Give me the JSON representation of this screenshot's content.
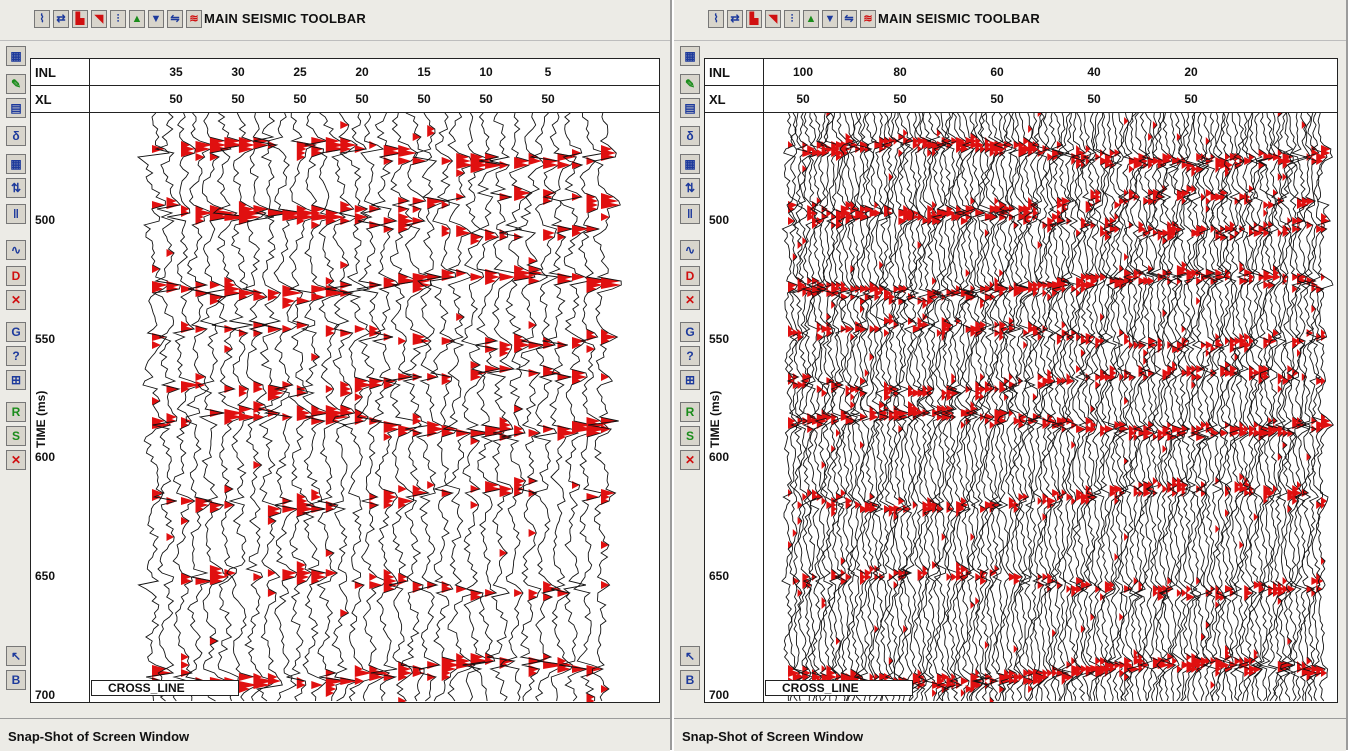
{
  "panels": [
    {
      "toolbar_title": "MAIN SEISMIC TOOLBAR",
      "inl_label": "INL",
      "xl_label": "XL",
      "inl_ticks": [
        "35",
        "30",
        "25",
        "20",
        "15",
        "10",
        "5"
      ],
      "xl_ticks": [
        "50",
        "50",
        "50",
        "50",
        "50",
        "50",
        "50"
      ],
      "y_axis_label": "TIME (ms)",
      "time_ticks": [
        "500",
        "550",
        "600",
        "650",
        "700"
      ],
      "legend": "CROSS_LINE",
      "status": "Snap-Shot of Screen Window"
    },
    {
      "toolbar_title": "MAIN SEISMIC TOOLBAR",
      "inl_label": "INL",
      "xl_label": "XL",
      "inl_ticks": [
        "100",
        "80",
        "60",
        "40",
        "20"
      ],
      "xl_ticks": [
        "50",
        "50",
        "50",
        "50",
        "50"
      ],
      "y_axis_label": "TIME (ms)",
      "time_ticks": [
        "500",
        "550",
        "600",
        "650",
        "700"
      ],
      "legend": "CROSS_LINE",
      "status": "Snap-Shot of Screen Window"
    }
  ],
  "toolbar_icons": [
    "wiggle-icon",
    "flip-icon",
    "red-fill-icon",
    "red-arrow-icon",
    "traces-icon",
    "chart-icon",
    "color-fill-icon",
    "swap-icon",
    "palette-icon"
  ],
  "side_icons": [
    {
      "name": "plot-icon",
      "glyph": "▦"
    },
    {
      "name": "pencil-icon",
      "glyph": "✎"
    },
    {
      "name": "colorbar-icon",
      "glyph": "▤"
    },
    {
      "name": "dtdx-icon",
      "glyph": "δ"
    },
    {
      "name": "grid-icon",
      "glyph": "▦"
    },
    {
      "name": "sort-icon",
      "glyph": "⇅"
    },
    {
      "name": "ticks-icon",
      "glyph": "‖"
    },
    {
      "name": "wavelet-icon",
      "glyph": "∿"
    },
    {
      "name": "d-icon",
      "glyph": "D"
    },
    {
      "name": "x-trace-icon",
      "glyph": "✕"
    },
    {
      "name": "g-icon",
      "glyph": "G"
    },
    {
      "name": "question-icon",
      "glyph": "?"
    },
    {
      "name": "split-icon",
      "glyph": "⊞"
    },
    {
      "name": "r-icon",
      "glyph": "R"
    },
    {
      "name": "s-icon",
      "glyph": "S"
    },
    {
      "name": "cross-icon",
      "glyph": "✕"
    },
    {
      "name": "cursor-icon",
      "glyph": "↖"
    },
    {
      "name": "b-icon",
      "glyph": "B"
    }
  ],
  "colors": {
    "fill": "#e01010",
    "trace": "#111111",
    "chrome": "#ecebe6"
  },
  "traces": [
    {
      "count": 32,
      "amp": 17,
      "seed": 3,
      "fill_prob": 0.55
    },
    {
      "count": 112,
      "amp": 9,
      "seed": 11,
      "fill_prob": 0.35
    }
  ]
}
